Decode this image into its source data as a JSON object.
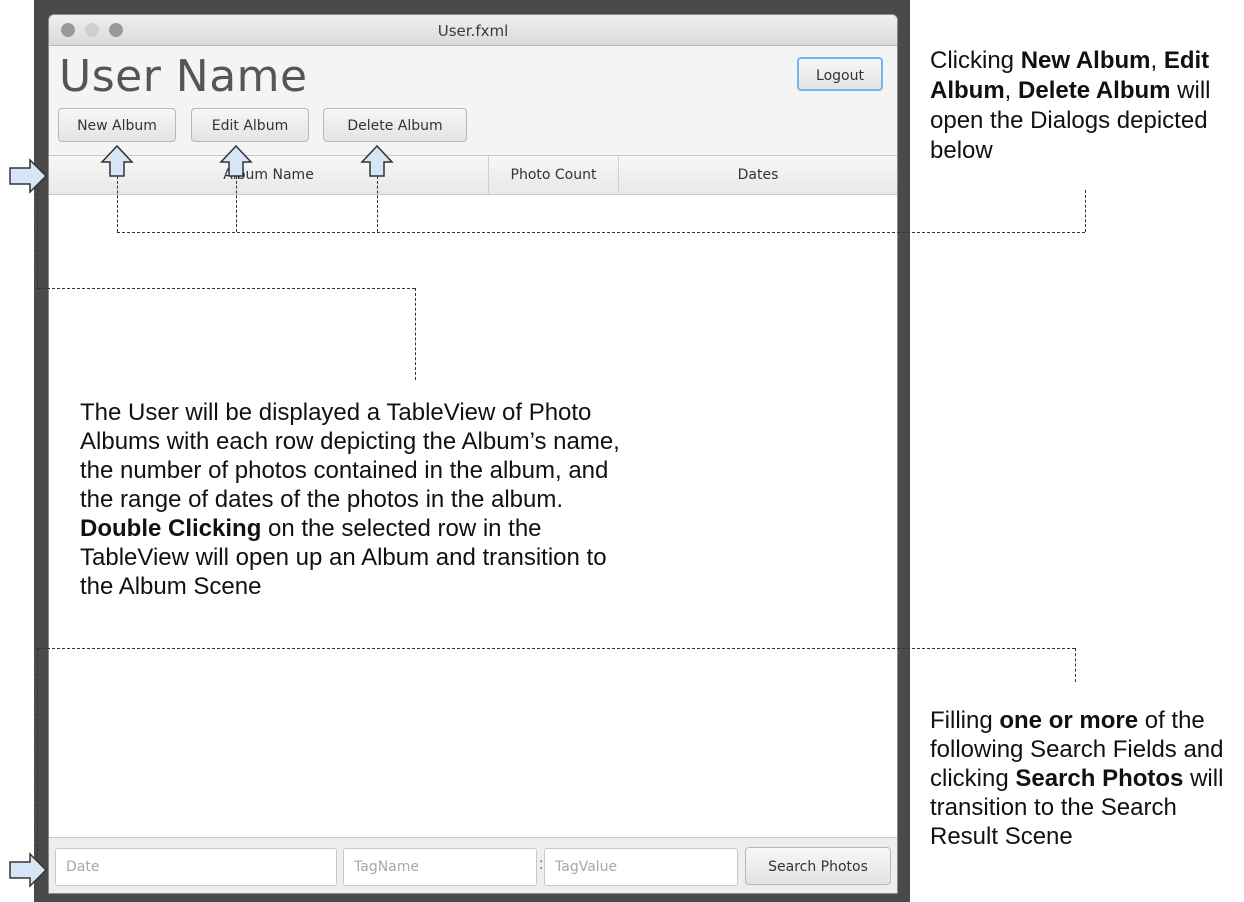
{
  "window": {
    "title": "User.fxml",
    "user_name": "User Name"
  },
  "toolbar": {
    "logout_label": "Logout",
    "new_album_label": "New Album",
    "edit_album_label": "Edit Album",
    "delete_album_label": "Delete Album"
  },
  "table": {
    "columns": [
      "Album Name",
      "Photo Count",
      "Dates"
    ],
    "rows": []
  },
  "search": {
    "date_placeholder": "Date",
    "tagname_placeholder": "TagName",
    "separator": ":",
    "tagvalue_placeholder": "TagValue",
    "button_label": "Search Photos"
  },
  "annotations": {
    "top": {
      "t1": "Clicking ",
      "b1": "New Album",
      "t2": ", ",
      "b2": "Edit Album",
      "t3": ", ",
      "b3": "Delete Album",
      "t4": " will open the Dialogs depicted below"
    },
    "middle": {
      "line1": "The User will be displayed a TableView of Photo",
      "line2": "Albums with each row depicting the Album’s name,",
      "line3": "the number of photos contained in the album, and",
      "line4": "the range of dates of the photos in the album.",
      "bold": "Double Clicking",
      "line5_rest": " on the selected row in the",
      "line6": "TableView will open up an Album and transition to",
      "line7": "the Album Scene"
    },
    "bottom": {
      "t1": "Filling ",
      "b1": "one or more",
      "t2": " of the following Search Fields and clicking ",
      "b2": "Search Photos",
      "t3": " will transition to the Search Result Scene"
    }
  },
  "colors": {
    "arrow_fill": "#d6e6f7",
    "focus_ring": "#7ab4ef",
    "frame": "#4a4a4a"
  }
}
